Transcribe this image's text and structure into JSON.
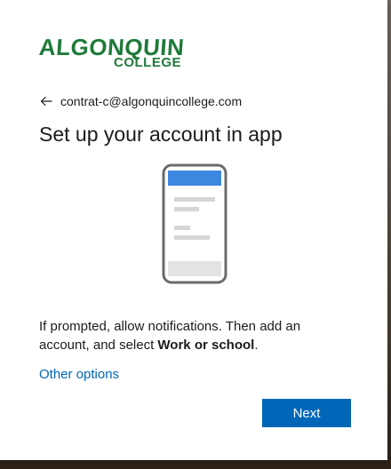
{
  "brand": {
    "logo_main": "ALGONQUIN",
    "logo_sub": "COLLEGE",
    "color": "#1f7a3a"
  },
  "identity": {
    "back_icon": "back-arrow-icon",
    "email": "contrat-c@algonquincollege.com"
  },
  "title": "Set up your account in app",
  "illustration": {
    "icon": "phone-illustration-icon",
    "accent": "#3c87e0"
  },
  "instructions": {
    "text_before": "If prompted, allow notifications. Then add an account, and select ",
    "emphasis": "Work or school",
    "text_after": "."
  },
  "links": {
    "other_options": "Other options"
  },
  "buttons": {
    "next": "Next",
    "accent": "#0067b8"
  }
}
